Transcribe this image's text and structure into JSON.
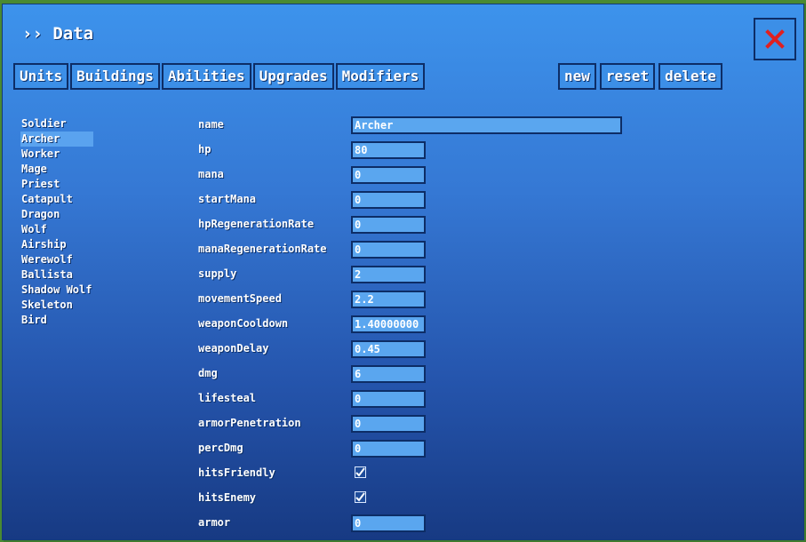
{
  "title": "›› Data",
  "tabs": [
    "Units",
    "Buildings",
    "Abilities",
    "Upgrades",
    "Modifiers"
  ],
  "actions": {
    "new": "new",
    "reset": "reset",
    "delete": "delete"
  },
  "units": [
    "Soldier",
    "Archer",
    "Worker",
    "Mage",
    "Priest",
    "Catapult",
    "Dragon",
    "Wolf",
    "Airship",
    "Werewolf",
    "Ballista",
    "Shadow Wolf",
    "Skeleton",
    "Bird"
  ],
  "selected_unit": "Archer",
  "fields": [
    {
      "label": "name",
      "value": "Archer",
      "type": "text-wide"
    },
    {
      "label": "hp",
      "value": "80",
      "type": "text"
    },
    {
      "label": "mana",
      "value": "0",
      "type": "text"
    },
    {
      "label": "startMana",
      "value": "0",
      "type": "text"
    },
    {
      "label": "hpRegenerationRate",
      "value": "0",
      "type": "text"
    },
    {
      "label": "manaRegenerationRate",
      "value": "0",
      "type": "text"
    },
    {
      "label": "supply",
      "value": "2",
      "type": "text"
    },
    {
      "label": "movementSpeed",
      "value": "2.2",
      "type": "text"
    },
    {
      "label": "weaponCooldown",
      "value": "1.40000000",
      "type": "text"
    },
    {
      "label": "weaponDelay",
      "value": "0.45",
      "type": "text"
    },
    {
      "label": "dmg",
      "value": "6",
      "type": "text"
    },
    {
      "label": "lifesteal",
      "value": "0",
      "type": "text"
    },
    {
      "label": "armorPenetration",
      "value": "0",
      "type": "text"
    },
    {
      "label": "percDmg",
      "value": "0",
      "type": "text"
    },
    {
      "label": "hitsFriendly",
      "value": "checked",
      "type": "checkbox"
    },
    {
      "label": "hitsEnemy",
      "value": "checked",
      "type": "checkbox"
    },
    {
      "label": "armor",
      "value": "0",
      "type": "text"
    }
  ],
  "colors": {
    "panel_top": "#3d93ec",
    "panel_bottom": "#173a83",
    "close_x": "#e02020",
    "button_bg": "#3c8fe7"
  }
}
